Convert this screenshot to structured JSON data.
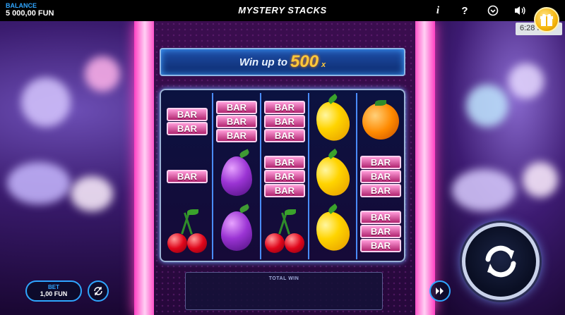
{
  "header": {
    "balance_label": "BALANCE",
    "balance_value": "5 000,00 FUN",
    "title": "MYSTERY STACKS",
    "info_glyph": "i",
    "help_glyph": "?",
    "clock": "6:28 PM"
  },
  "banner": {
    "prefix": "Win up to",
    "amount": "500",
    "suffix": "x"
  },
  "reels": [
    [
      "bar-2",
      "bar-1",
      "cherries"
    ],
    [
      "bar-3",
      "plum",
      "plum"
    ],
    [
      "bar-3",
      "bar-3",
      "cherries"
    ],
    [
      "lemon",
      "lemon",
      "lemon"
    ],
    [
      "orange",
      "bar-3",
      "bar-3"
    ]
  ],
  "symbol_text": {
    "bar": "BAR"
  },
  "total_win": {
    "label": "TOTAL WIN"
  },
  "bet": {
    "label": "BET",
    "value": "1,00 FUN"
  },
  "colors": {
    "accent": "#2fa6ff",
    "neon_pink": "#ff3fc2",
    "gold": "#ffc83a"
  },
  "icons": [
    "info-icon",
    "help-icon",
    "history-icon",
    "sound-icon",
    "gift-icon",
    "autoplay-icon",
    "turbo-icon",
    "spin-icon"
  ]
}
